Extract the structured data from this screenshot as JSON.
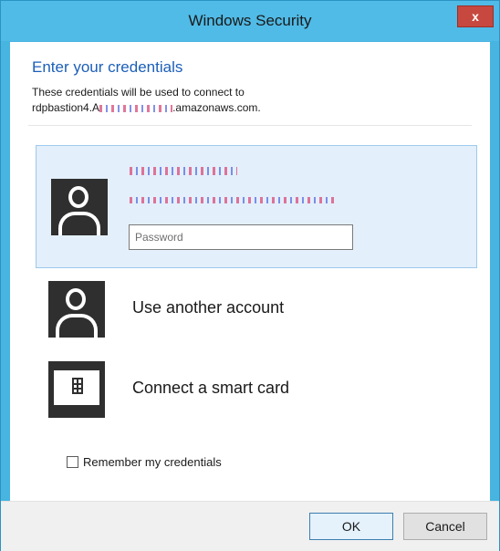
{
  "window": {
    "title": "Windows Security",
    "close_label": "x"
  },
  "prompt": {
    "heading": "Enter your credentials",
    "line1": "These credentials will be used to connect to",
    "host_prefix": "rdpbastion4.A",
    "host_suffix": ".amazonaws.com."
  },
  "selected_account": {
    "password_placeholder": "Password"
  },
  "options": [
    {
      "label": "Use another account",
      "icon": "user-avatar-icon"
    },
    {
      "label": "Connect a smart card",
      "icon": "smart-card-icon"
    }
  ],
  "remember": {
    "label": "Remember my credentials",
    "checked": false
  },
  "buttons": {
    "ok": "OK",
    "cancel": "Cancel"
  },
  "colors": {
    "title_bar": "#50bbe6",
    "heading": "#1b5fb8",
    "selected_tile": "#e3effb",
    "close_button": "#c7483f"
  }
}
